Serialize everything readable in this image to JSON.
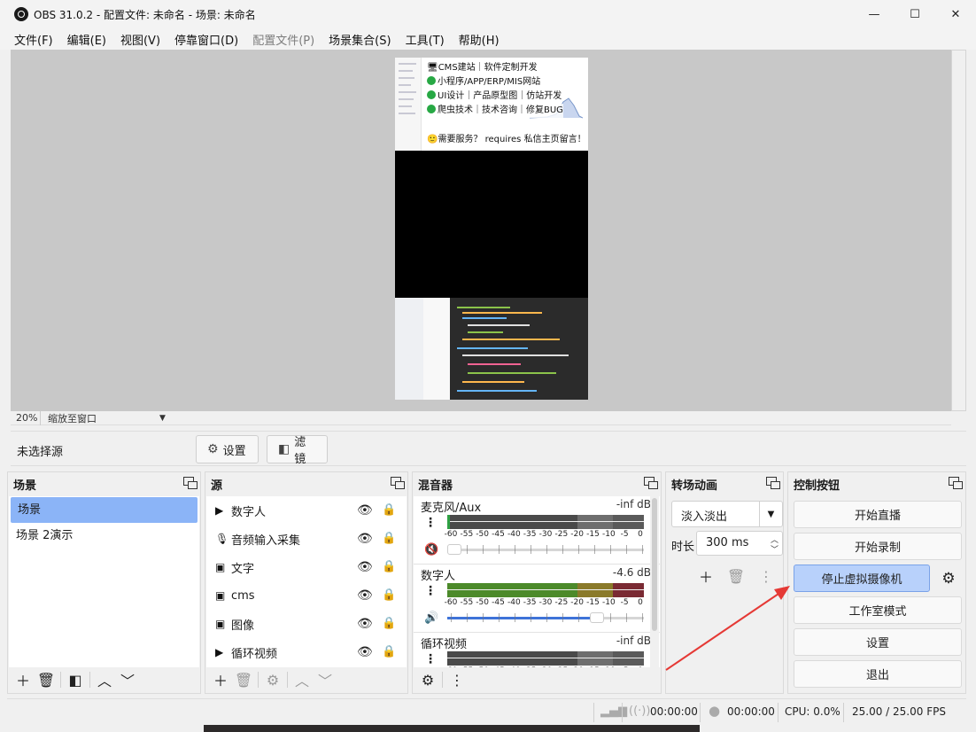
{
  "window": {
    "title": "OBS 31.0.2 - 配置文件: 未命名 - 场景: 未命名",
    "minimize": "—",
    "maximize": "☐",
    "close": "✕"
  },
  "menu": [
    "文件(F)",
    "编辑(E)",
    "视图(V)",
    "停靠窗口(D)",
    "配置文件(P)",
    "场景集合(S)",
    "工具(T)",
    "帮助(H)"
  ],
  "preview": {
    "zoom": "20%",
    "zoom_mode": "缩放至窗口",
    "overlay": {
      "line1": "CMS建站｜软件定制开发",
      "line2": "小程序/APP/ERP/MIS网站",
      "line3": "UI设计｜产品原型图｜仿站开发",
      "line4": "爬虫技术｜技术咨询｜修复BUG",
      "line5": "需要服务？ requires 私信主页留言！"
    }
  },
  "context": {
    "no_source": "未选择源",
    "settings": "设置",
    "filters": "滤镜"
  },
  "scenes": {
    "title": "场景",
    "items": [
      "场景",
      "场景 2演示"
    ],
    "selected": 0
  },
  "sources": {
    "title": "源",
    "items": [
      {
        "name": "数字人",
        "icon": "play-icon"
      },
      {
        "name": "音频输入采集",
        "icon": "microphone-icon"
      },
      {
        "name": "文字",
        "icon": "image-icon"
      },
      {
        "name": "cms",
        "icon": "image-icon"
      },
      {
        "name": "图像",
        "icon": "image-icon"
      },
      {
        "name": "循环视频",
        "icon": "play-icon"
      }
    ]
  },
  "mixer": {
    "title": "混音器",
    "scale": [
      "-60",
      "-55",
      "-50",
      "-45",
      "-40",
      "-35",
      "-30",
      "-25",
      "-20",
      "-15",
      "-10",
      "-5",
      "0"
    ],
    "channels": [
      {
        "name": "麦克风/Aux",
        "db": "-inf dB",
        "muted": true,
        "volume": 0.0,
        "level": 0.0
      },
      {
        "name": "数字人",
        "db": "-4.6 dB",
        "muted": false,
        "volume": 0.78,
        "level": 1.0
      },
      {
        "name": "循环视频",
        "db": "-inf dB",
        "muted": false,
        "volume": 0.0,
        "level": 0.0
      }
    ]
  },
  "transitions": {
    "title": "转场动画",
    "selected": "淡入淡出",
    "duration_label": "时长",
    "duration": "300 ms"
  },
  "controls": {
    "title": "控制按钮",
    "start_stream": "开始直播",
    "start_record": "开始录制",
    "stop_virtual_cam": "停止虚拟摄像机",
    "studio_mode": "工作室模式",
    "settings": "设置",
    "exit": "退出"
  },
  "status": {
    "stream_time": "00:00:00",
    "record_time": "00:00:00",
    "cpu": "CPU: 0.0%",
    "fps": "25.00 / 25.00 FPS"
  },
  "colors": {
    "selected": "#8bb4f7",
    "active_button": "#b8d1fb",
    "meter_green": "#4c8a2a",
    "meter_yellow": "#8a7a2a",
    "meter_red": "#7a2a33",
    "slider_blue": "#3e73d8",
    "arrow_red": "#e53935"
  }
}
